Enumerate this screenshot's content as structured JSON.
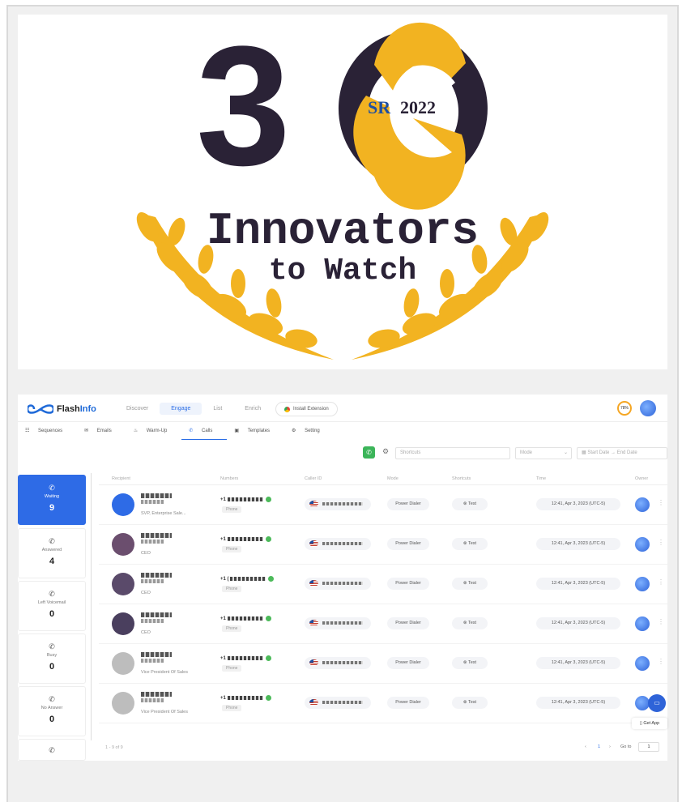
{
  "banner": {
    "number": "30",
    "badge_left": "SR",
    "badge_right": "2022",
    "line1": "Innovators",
    "line2": "to Watch"
  },
  "app": {
    "logo": {
      "part1": "Flash",
      "part2": "Info"
    },
    "top_nav": [
      "Discover",
      "Engage",
      "List",
      "Enrich"
    ],
    "top_nav_active": "Engage",
    "extension_button": "Install Extension",
    "score": "78%",
    "sub_nav": [
      "Sequences",
      "Emails",
      "Warm-Up",
      "Calls",
      "Templates",
      "Setting"
    ],
    "sub_nav_active": "Calls",
    "filters": {
      "shortcuts_placeholder": "Shortcuts",
      "mode_placeholder": "Mode",
      "start_date": "Start Date",
      "end_date": "End Date"
    },
    "sidebar": [
      {
        "label": "Waiting",
        "count": "9",
        "icon": "phone-incoming-icon"
      },
      {
        "label": "Answered",
        "count": "4",
        "icon": "phone-answered-icon"
      },
      {
        "label": "Left Voicemail",
        "count": "0",
        "icon": "voicemail-icon"
      },
      {
        "label": "Busy",
        "count": "0",
        "icon": "phone-busy-icon"
      },
      {
        "label": "No Answer",
        "count": "0",
        "icon": "phone-missed-icon"
      }
    ],
    "table": {
      "headers": [
        "Recipient",
        "Numbers",
        "Caller ID",
        "Mode",
        "Shortcuts",
        "Time",
        "Owner"
      ],
      "rows": [
        {
          "title": "SVP, Enterprise Sale...",
          "phone_prefix": "+1",
          "phone_tag": "Phone",
          "mode": "Power Dialer",
          "shortcut": "Test",
          "time": "12:41, Apr 3, 2023 (UTC-5)",
          "avatar_color": "#2e6be6"
        },
        {
          "title": "CEO",
          "phone_prefix": "+1",
          "phone_tag": "Phone",
          "mode": "Power Dialer",
          "shortcut": "Test",
          "time": "12:41, Apr 3, 2023 (UTC-5)",
          "avatar_color": "#6b4e6e"
        },
        {
          "title": "CEO",
          "phone_prefix": "+1 (",
          "phone_tag": "Phone",
          "mode": "Power Dialer",
          "shortcut": "Test",
          "time": "12:41, Apr 3, 2023 (UTC-5)",
          "avatar_color": "#5a4a6a"
        },
        {
          "title": "CEO",
          "phone_prefix": "+1",
          "phone_tag": "Phone",
          "mode": "Power Dialer",
          "shortcut": "Test",
          "time": "12:41, Apr 3, 2023 (UTC-5)",
          "avatar_color": "#4a3f5e"
        },
        {
          "title": "Vice President Of Sales",
          "phone_prefix": "+1",
          "phone_tag": "Phone",
          "mode": "Power Dialer",
          "shortcut": "Test",
          "time": "12:41, Apr 3, 2023 (UTC-5)",
          "avatar_color": "#bdbdbd"
        },
        {
          "title": "Vice President Of Sales",
          "phone_prefix": "+1",
          "phone_tag": "Phone",
          "mode": "Power Dialer",
          "shortcut": "Test",
          "time": "12:41, Apr 3, 2023 (UTC-5)",
          "avatar_color": "#bdbdbd"
        }
      ]
    },
    "pager": {
      "summary": "1 - 9 of 9",
      "current_page": "1",
      "goto_label": "Go to",
      "goto_value": "1"
    },
    "get_app": "Get App"
  }
}
